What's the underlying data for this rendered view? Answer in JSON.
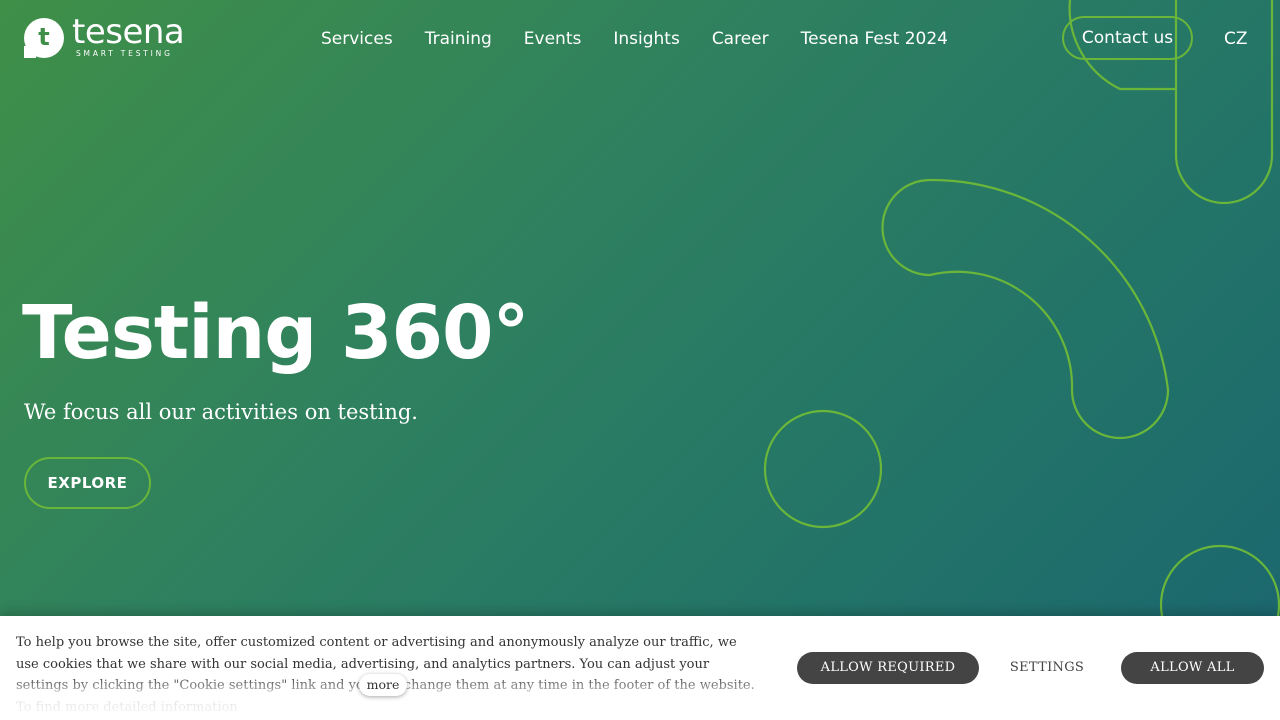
{
  "header": {
    "logo": {
      "mark": "t",
      "name": "tesena",
      "tagline": "SMART TESTING"
    },
    "nav": [
      "Services",
      "Training",
      "Events",
      "Insights",
      "Career",
      "Tesena Fest 2024"
    ],
    "contact_label": "Contact us",
    "language": "CZ"
  },
  "hero": {
    "title": "Testing 360°",
    "subtitle": "We focus all our activities on testing.",
    "cta_label": "EXPLORE"
  },
  "cookie_banner": {
    "text": "To help you browse the site, offer customized content or advertising and anonymously analyze our traffic, we use cookies that we share with our social media, advertising, and analytics partners. You can adjust your settings by clicking the \"Cookie settings\" link and you can change them at any time in the footer of the website. To find more detailed information",
    "more_label": "more",
    "allow_required_label": "ALLOW REQUIRED",
    "settings_label": "SETTINGS",
    "allow_all_label": "ALLOW ALL"
  },
  "colors": {
    "accent_green": "#6ab63a",
    "gradient_start": "#3f8f48",
    "gradient_end": "#1a6570",
    "button_dark": "#444444"
  }
}
